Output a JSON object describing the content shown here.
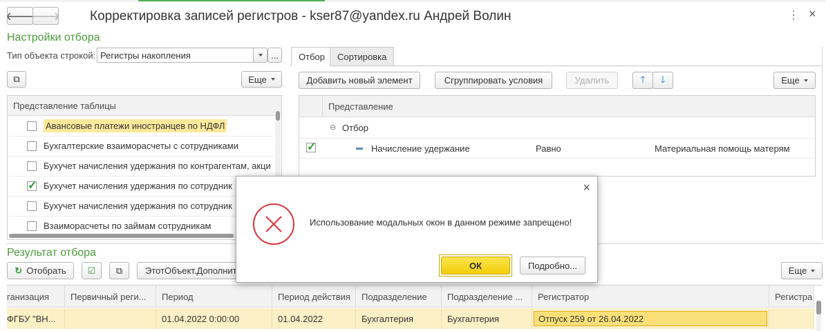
{
  "window": {
    "title": "Корректировка записей регистров - kser87@yandex.ru Андрей Волин"
  },
  "filter_settings": {
    "heading": "Настройки отбора",
    "object_type_label": "Тип объекта строкой:",
    "object_type_value": "Регистры накопления",
    "more_label": "Еще",
    "list_header": "Представление таблицы",
    "items": [
      {
        "label": "Авансовые платежи иностранцев по НДФЛ",
        "checked": false,
        "highlight": true
      },
      {
        "label": "Бухгалтерские взаиморасчеты с сотрудниками",
        "checked": false
      },
      {
        "label": "Бухучет начисления удержания по контрагентам, акци",
        "checked": false
      },
      {
        "label": "Бухучет начисления удержания по сотрудник",
        "checked": true
      },
      {
        "label": "Бухучет начисления удержания по сотрудник",
        "checked": false
      },
      {
        "label": "Взаиморасчеты по займам сотрудникам",
        "checked": false
      }
    ]
  },
  "tabs": {
    "filter": "Отбор",
    "sort": "Сортировка"
  },
  "filter_toolbar": {
    "add": "Добавить новый элемент",
    "group": "Сгруппировать условия",
    "delete": "Удалить",
    "more": "Еще"
  },
  "filter_table": {
    "header": "Представление",
    "group_label": "Отбор",
    "condition": {
      "field": "Начисление удержание",
      "comparison": "Равно",
      "value": "Материальная помощь матерям"
    }
  },
  "results": {
    "heading": "Результат отбора",
    "select_button": "Отобрать",
    "object_button": "ЭтотОбъект.Дополнит",
    "more_label": "Еще",
    "columns": [
      "ганизация",
      "Первичный реги...",
      "Период",
      "Период действия",
      "Подразделение",
      "Подразделение ...",
      "Регистратор",
      "Регистра"
    ],
    "row": [
      "ФГБУ \"ВН...",
      "",
      "01.04.2022 0:00:00",
      "01.04.2022",
      "Бухгалтерия",
      "Бухгалтерия",
      "Отпуск 259 от 26.04.2022",
      ""
    ]
  },
  "dialog": {
    "message": "Использование модальных окон в данном режиме запрещено!",
    "ok": "ОК",
    "details": "Подробно..."
  },
  "colors": {
    "accent_green": "#4b9b3c",
    "error_red": "#d9363e",
    "ok_yellow": "#f2cd08",
    "row_highlight": "#fbf0c6"
  }
}
